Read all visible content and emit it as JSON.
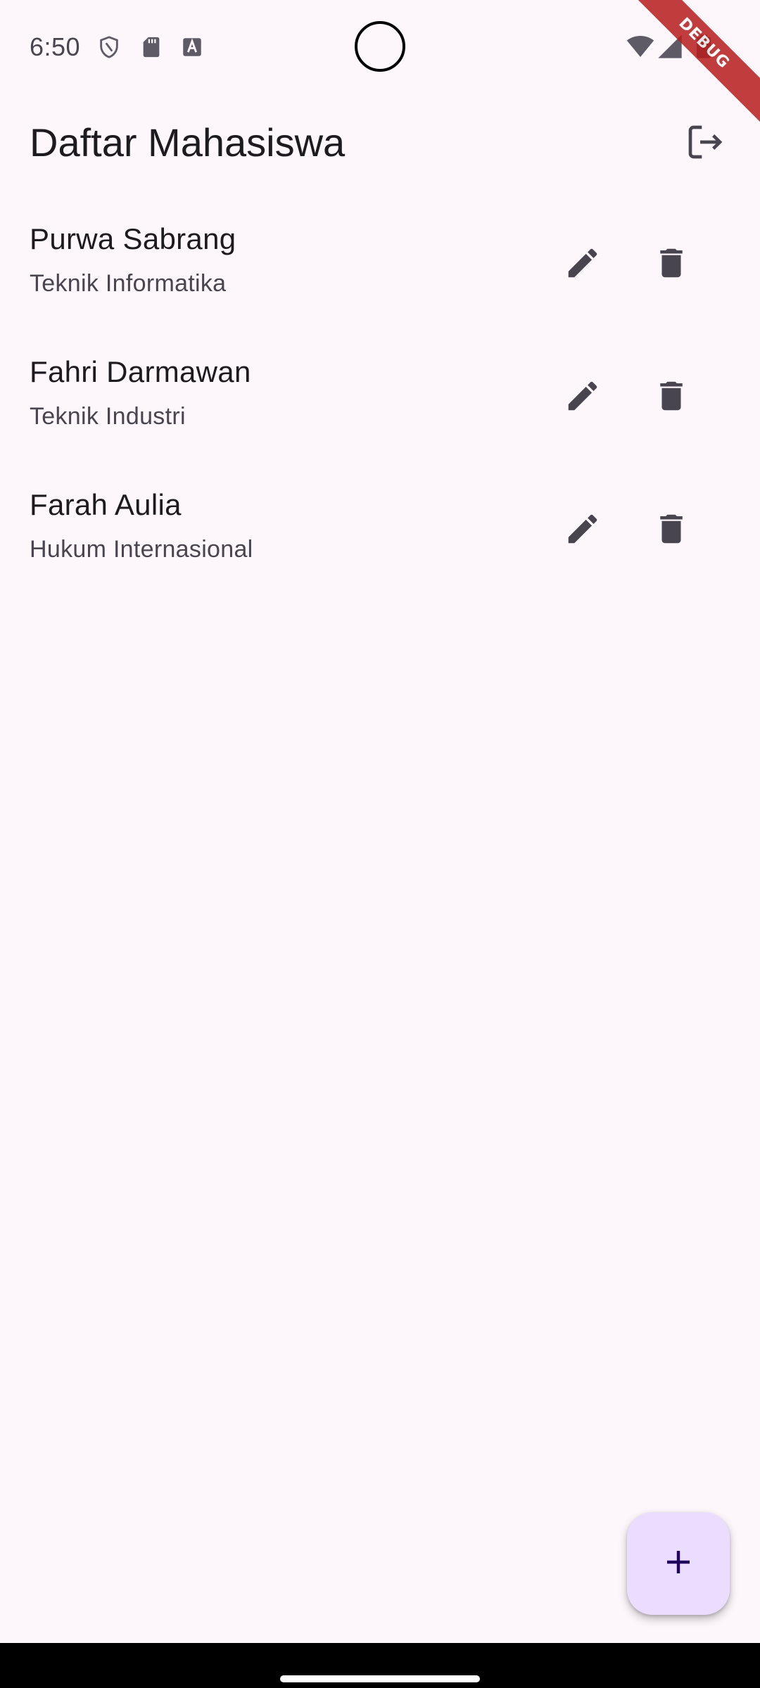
{
  "status_bar": {
    "time": "6:50",
    "left_icons": [
      "shield-icon",
      "sd-card-icon",
      "text-a-icon"
    ],
    "right_icons": [
      "wifi-icon",
      "signal-icon",
      "battery-icon"
    ]
  },
  "debug_banner": "DEBUG",
  "app_bar": {
    "title": "Daftar Mahasiswa",
    "action_icon": "logout-icon"
  },
  "students": [
    {
      "name": "Purwa Sabrang",
      "major": "Teknik Informatika"
    },
    {
      "name": "Fahri Darmawan",
      "major": "Teknik Industri"
    },
    {
      "name": "Farah Aulia",
      "major": "Hukum Internasional"
    }
  ],
  "fab": {
    "icon": "plus-icon"
  },
  "colors": {
    "background": "#fdf7fc",
    "icon": "#49454f",
    "fab": "#eaddff",
    "fab_icon": "#21005d",
    "debug": "#b71c1c"
  }
}
